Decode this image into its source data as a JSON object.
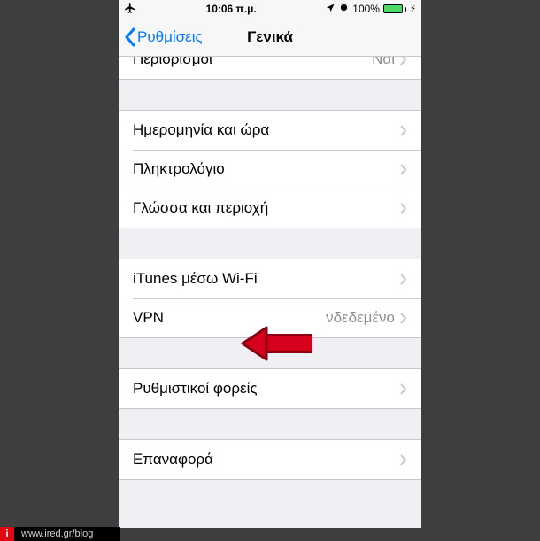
{
  "status": {
    "time": "10:06 π.μ.",
    "battery_pct": "100%"
  },
  "nav": {
    "back_label": "Ρυθμίσεις",
    "title": "Γενικά"
  },
  "groups": [
    {
      "rows": [
        {
          "label": "Περιορισμοί",
          "value": "Ναι"
        }
      ]
    },
    {
      "rows": [
        {
          "label": "Ημερομηνία και ώρα"
        },
        {
          "label": "Πληκτρολόγιο"
        },
        {
          "label": "Γλώσσα και περιοχή"
        }
      ]
    },
    {
      "rows": [
        {
          "label": "iTunes μέσω Wi-Fi"
        },
        {
          "label": "VPN",
          "value": "νδεδεμένο"
        }
      ]
    },
    {
      "rows": [
        {
          "label": "Ρυθμιστικοί φορείς"
        }
      ]
    },
    {
      "rows": [
        {
          "label": "Επαναφορά"
        }
      ]
    }
  ],
  "footer": {
    "badge": "i",
    "url": "www.ired.gr/blog"
  },
  "colors": {
    "tint": "#007aff",
    "arrow": "#d6001c"
  }
}
